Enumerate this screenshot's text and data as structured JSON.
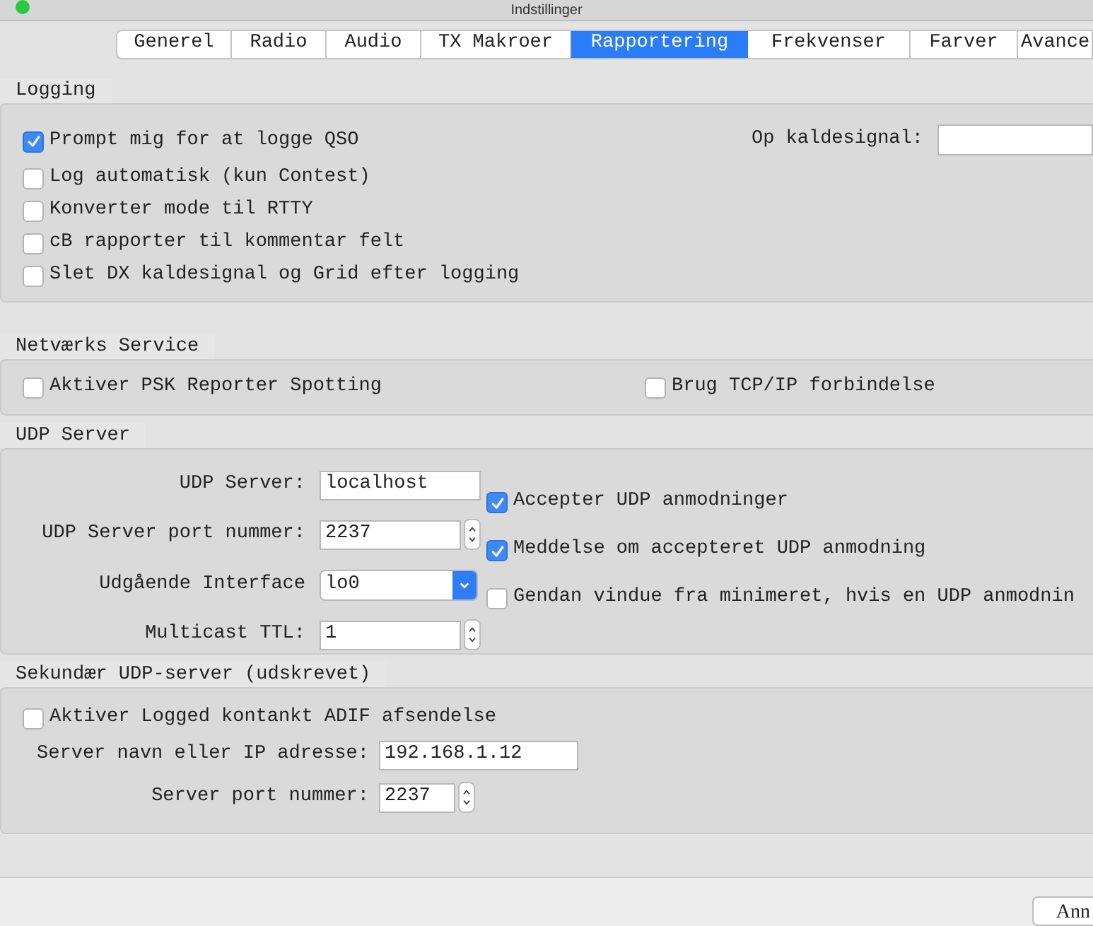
{
  "window": {
    "title": "Indstillinger"
  },
  "tabs": [
    {
      "label": "Generel",
      "selected": false
    },
    {
      "label": "Radio",
      "selected": false
    },
    {
      "label": "Audio",
      "selected": false
    },
    {
      "label": "TX Makroer",
      "selected": false
    },
    {
      "label": "Rapportering",
      "selected": true
    },
    {
      "label": "Frekvenser",
      "selected": false
    },
    {
      "label": "Farver",
      "selected": false
    },
    {
      "label": "Avance",
      "selected": false
    }
  ],
  "logging": {
    "title": "Logging",
    "options": [
      {
        "label": "Prompt mig for at logge QSO",
        "checked": true
      },
      {
        "label": "Log automatisk (kun Contest)",
        "checked": false
      },
      {
        "label": "Konverter mode til RTTY",
        "checked": false
      },
      {
        "label": "cB rapporter til kommentar felt",
        "checked": false
      },
      {
        "label": "Slet DX kaldesignal og Grid efter logging",
        "checked": false
      }
    ],
    "callsign_label": "Op kaldesignal:"
  },
  "network_service": {
    "title": "Netværks Service",
    "options": [
      {
        "label": "Aktiver PSK Reporter Spotting",
        "checked": false
      },
      {
        "label": "Brug TCP/IP forbindelse",
        "checked": false
      }
    ]
  },
  "udp_server": {
    "title": "UDP Server",
    "fields": [
      {
        "kind": "text",
        "label": "UDP Server:",
        "value": "localhost"
      },
      {
        "kind": "spin",
        "label": "UDP Server port nummer:",
        "value": "2237"
      },
      {
        "kind": "combo",
        "label": "Udgående Interface",
        "value": "lo0"
      },
      {
        "kind": "spin",
        "label": "Multicast TTL:",
        "value": "1"
      }
    ],
    "options": [
      {
        "label": "Accepter UDP anmodninger",
        "checked": true
      },
      {
        "label": "Meddelse om accepteret UDP anmodning",
        "checked": true
      },
      {
        "label": "Gendan vindue fra minimeret, hvis en UDP anmodnin",
        "checked": false
      }
    ]
  },
  "secondary_udp_server": {
    "title": "Sekundær UDP-server (udskrevet)",
    "options": [
      {
        "label": "Aktiver Logged kontankt ADIF afsendelse",
        "checked": false
      }
    ],
    "fields": [
      {
        "kind": "text",
        "label": "Server navn eller IP adresse:",
        "value": "192.168.1.12"
      },
      {
        "kind": "spin",
        "label": "Server port nummer:",
        "value": "2237"
      }
    ]
  },
  "buttons": [
    "Ann"
  ]
}
